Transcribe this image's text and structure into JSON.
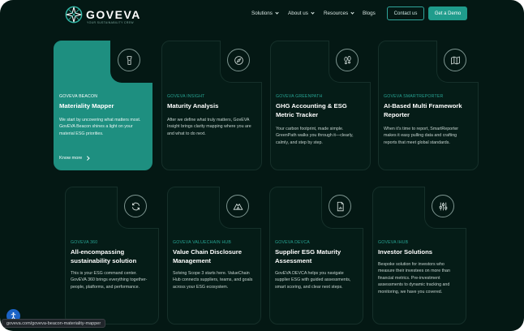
{
  "header": {
    "logo_text": "GOVEVA",
    "logo_tagline": "YOUR SUSTAINABILITY CREW",
    "nav": [
      {
        "label": "Solutions",
        "has_dropdown": true
      },
      {
        "label": "About us",
        "has_dropdown": true
      },
      {
        "label": "Resources",
        "has_dropdown": true
      },
      {
        "label": "Blogs",
        "has_dropdown": false
      }
    ],
    "contact_label": "Contact us",
    "demo_label": "Get a Demo"
  },
  "cards": [
    {
      "tag": "GOVEVA BEACON",
      "title": "Materiality Mapper",
      "desc": "We start by uncovering what matters most. GovEVA Beacon shines a light on your material ESG priorities.",
      "icon": "beacon-icon",
      "link": "Know more"
    },
    {
      "tag": "GOVEVA INSIGHT",
      "title": "Maturity Analysis",
      "desc": "After we define what truly matters, GovEVA Insight brings clarity mapping where you are and what to do next.",
      "icon": "compass-icon"
    },
    {
      "tag": "GOVEVA GREENPATH",
      "title": "GHG Accounting & ESG Metric Tracker",
      "desc": "Your carbon footprint, made simple. GreenPath walks you through it—clearly, calmly, and step by step.",
      "icon": "footprints-icon"
    },
    {
      "tag": "GOVEVA SMARTREPORTER",
      "title": "AI-Based Multi Framework Reporter",
      "desc": "When it’s time to report, SmartReporter makes it easy pulling data and crafting reports that meet global standards.",
      "icon": "map-icon"
    },
    {
      "tag": "GOVEVA 360",
      "title": "All-encompassing sustainability solution",
      "desc": "This is your ESG command center. GovEVA 360 brings everything together-people, platforms, and performance.",
      "icon": "refresh-icon"
    },
    {
      "tag": "GOVEVA VALUECHAIN HUB",
      "title": "Value Chain Disclosure Management",
      "desc": "Solving Scope 3 starts here. ValueChain Hub connects suppliers, teams, and goals across your ESG ecosystem.",
      "icon": "tent-icon"
    },
    {
      "tag": "GOVEVA DEVCA",
      "title": "Supplier ESG Maturity Assessment",
      "desc": "GovEVA DEVCA helps you navigate supplier ESG with guided assessments, smart scoring, and clear next steps.",
      "icon": "report-icon"
    },
    {
      "tag": "GOVEVA IHUB",
      "title": "Investor Solutions",
      "desc": "Bespoke solution for investors who measure their investees on more than financial metrics. Pre-investment assessments to dynamic tracking and monitoring, we have you covered.",
      "icon": "sliders-icon"
    }
  ],
  "status": {
    "url": "goveva.com/goveva-beacon-materiality-mapper"
  },
  "colors": {
    "background": "#041814",
    "accent": "#1e8f80",
    "tag": "#27a493"
  }
}
